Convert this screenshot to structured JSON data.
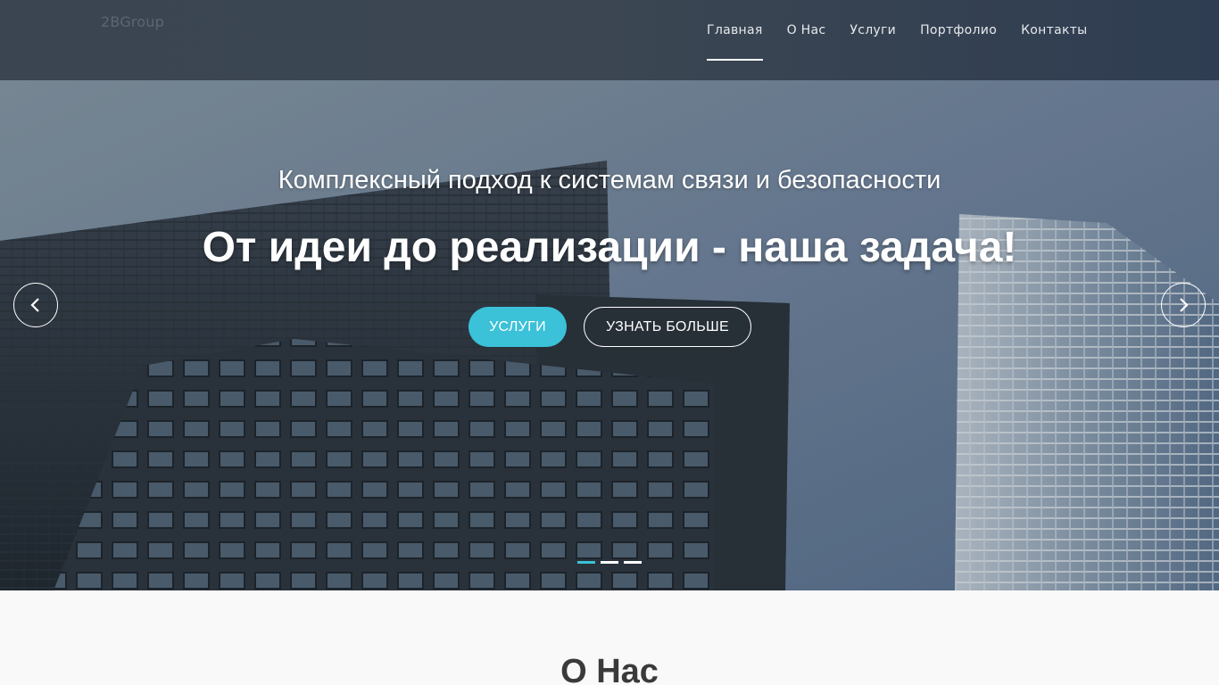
{
  "header": {
    "logo": "2BGroup",
    "nav": [
      {
        "label": "Главная",
        "active": true
      },
      {
        "label": "О Нас",
        "active": false
      },
      {
        "label": "Услуги",
        "active": false
      },
      {
        "label": "Портфолио",
        "active": false
      },
      {
        "label": "Контакты",
        "active": false
      }
    ]
  },
  "hero": {
    "subtitle": "Комплексный подход к системам связи и безопасности",
    "title": "От идеи до реализации - наша задача!",
    "primary_button": "УСЛУГИ",
    "secondary_button": "УЗНАТЬ БОЛЬШЕ",
    "prev_icon": "chevron-left-icon",
    "next_icon": "chevron-right-icon",
    "slides_total": 3,
    "active_slide": 1
  },
  "about": {
    "title": "О Нас"
  },
  "colors": {
    "accent": "#3bc1d8",
    "header_bg": "#3a4551",
    "text_dark": "#3a3a3a"
  }
}
